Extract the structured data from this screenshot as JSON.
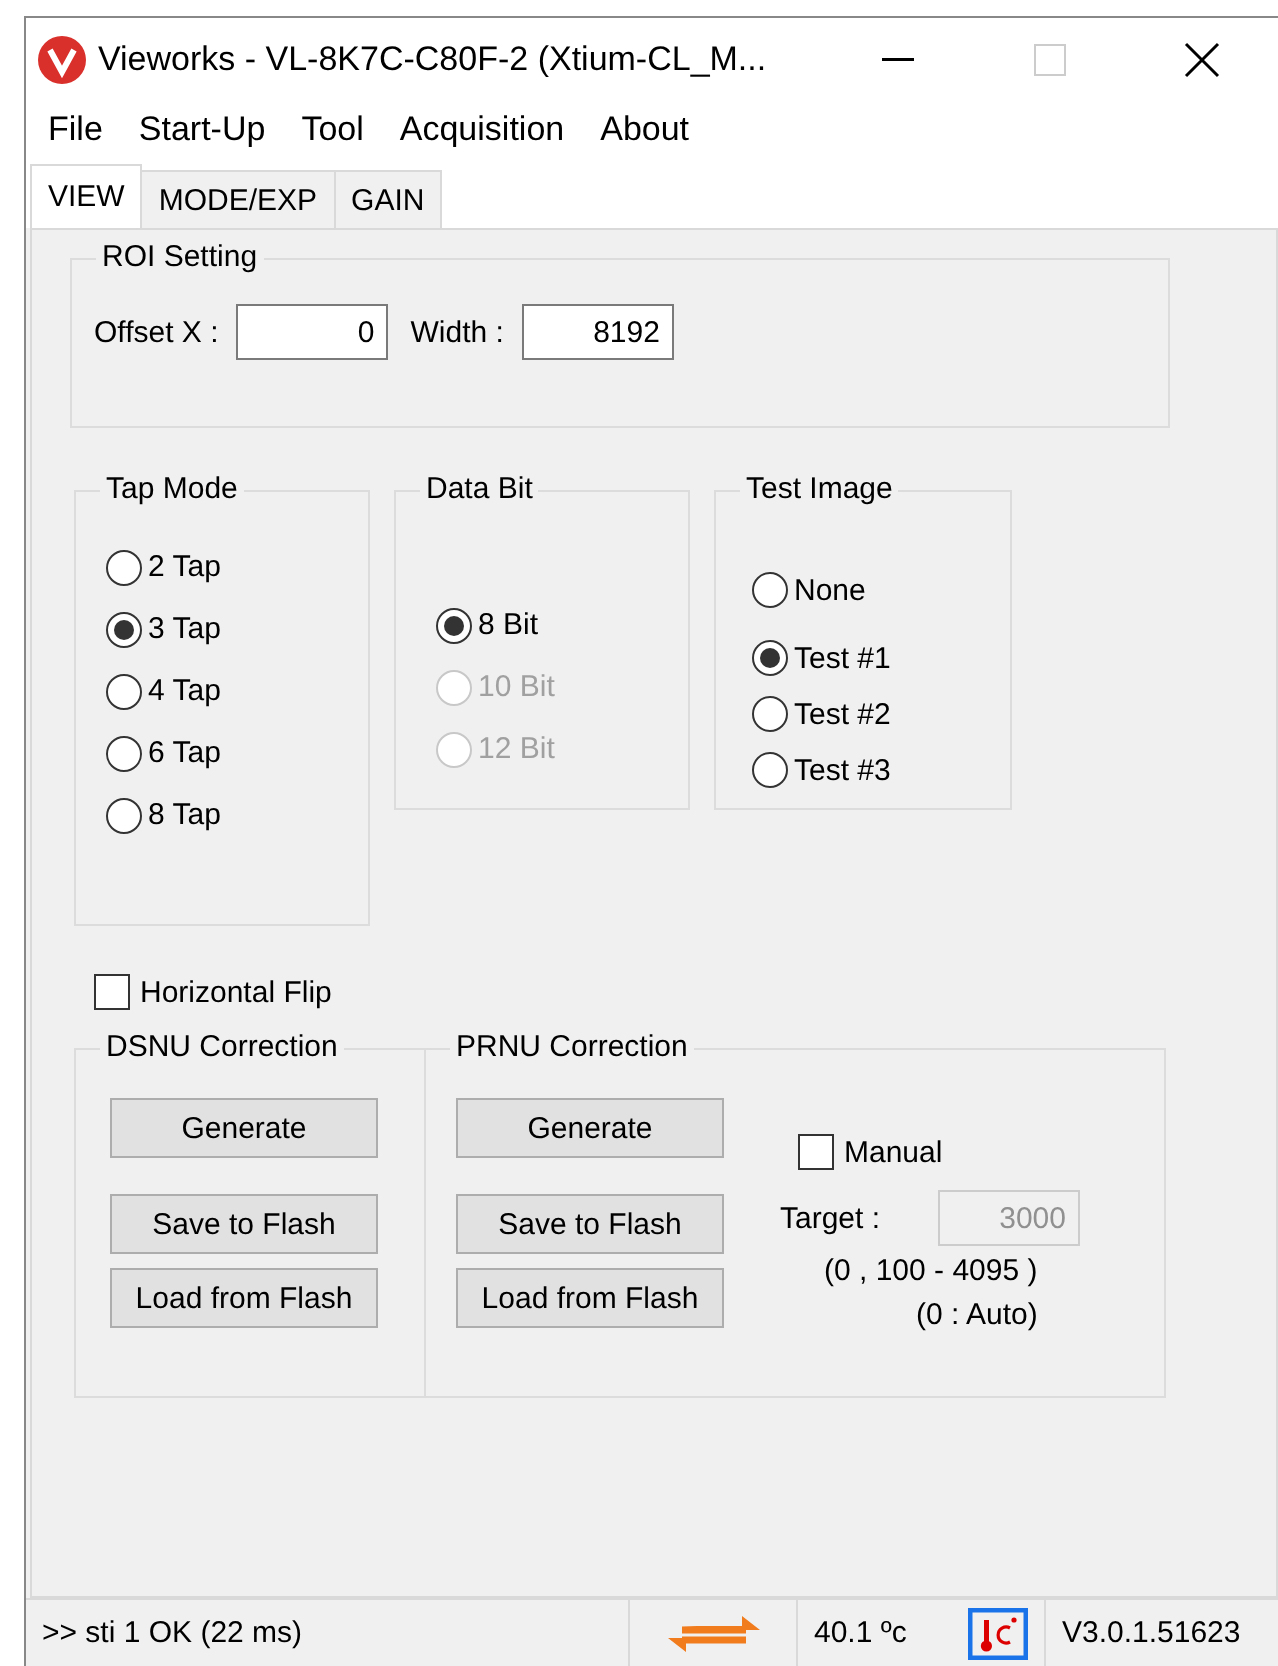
{
  "window": {
    "title": "Vieworks - VL-8K7C-C80F-2 (Xtium-CL_M..."
  },
  "menu": [
    "File",
    "Start-Up",
    "Tool",
    "Acquisition",
    "About"
  ],
  "tabs": [
    {
      "label": "VIEW",
      "selected": true
    },
    {
      "label": "MODE/EXP",
      "selected": false
    },
    {
      "label": "GAIN",
      "selected": false
    }
  ],
  "roi": {
    "title": "ROI Setting",
    "fields": [
      {
        "label": "Offset X :",
        "value": "0"
      },
      {
        "label": "Width :",
        "value": "8192"
      }
    ]
  },
  "tap_mode": {
    "title": "Tap Mode",
    "options": [
      {
        "label": "2 Tap",
        "selected": false,
        "disabled": false
      },
      {
        "label": "3 Tap",
        "selected": true,
        "disabled": false
      },
      {
        "label": "4 Tap",
        "selected": false,
        "disabled": false
      },
      {
        "label": "6 Tap",
        "selected": false,
        "disabled": false
      },
      {
        "label": "8 Tap",
        "selected": false,
        "disabled": false
      }
    ]
  },
  "data_bit": {
    "title": "Data Bit",
    "options": [
      {
        "label": "8 Bit",
        "selected": true,
        "disabled": false
      },
      {
        "label": "10 Bit",
        "selected": false,
        "disabled": true
      },
      {
        "label": "12 Bit",
        "selected": false,
        "disabled": true
      }
    ]
  },
  "test_image": {
    "title": "Test Image",
    "options": [
      {
        "label": "None",
        "selected": false,
        "disabled": false
      },
      {
        "label": "Test #1",
        "selected": true,
        "disabled": false
      },
      {
        "label": "Test #2",
        "selected": false,
        "disabled": false
      },
      {
        "label": "Test #3",
        "selected": false,
        "disabled": false
      }
    ]
  },
  "horizontal_flip": {
    "label": "Horizontal Flip",
    "checked": false
  },
  "dsnu": {
    "title": "DSNU Correction",
    "buttons": [
      "Generate",
      "Save to Flash",
      "Load from Flash"
    ]
  },
  "prnu": {
    "title": "PRNU Correction",
    "buttons": [
      "Generate",
      "Save to Flash",
      "Load from Flash"
    ],
    "manual": {
      "label": "Manual",
      "checked": false
    },
    "target": {
      "label": "Target :",
      "value": "3000",
      "disabled": true
    },
    "range": "(0 , 100 - 4095 )",
    "auto_note": "(0 : Auto)"
  },
  "status_bar": {
    "message": ">> sti 1  OK  (22 ms)",
    "temperature": "40.1 ºc",
    "version": "V3.0.1.51623"
  }
}
